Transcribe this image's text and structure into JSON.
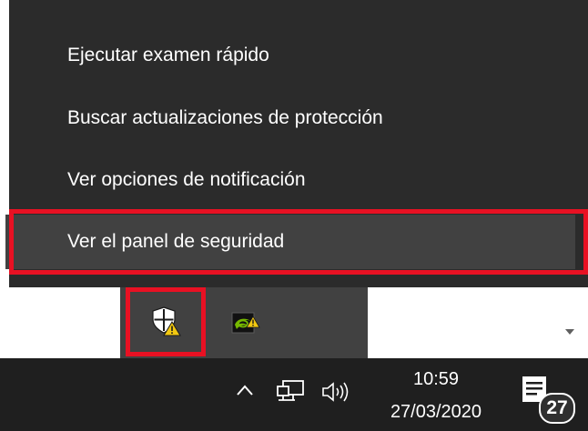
{
  "context_menu": {
    "items": [
      {
        "label": "Ejecutar examen rápido"
      },
      {
        "label": "Buscar actualizaciones de protección"
      },
      {
        "label": "Ver opciones de notificación"
      },
      {
        "label": "Ver el panel de seguridad"
      }
    ]
  },
  "tray_overflow": {
    "icons": [
      "windows-security-warning-icon",
      "nvidia-icon"
    ]
  },
  "taskbar": {
    "time": "10:59",
    "date": "27/03/2020",
    "notification_count": "27",
    "icons": [
      "chevron-up-icon",
      "network-icon",
      "volume-icon",
      "action-center-icon"
    ]
  },
  "colors": {
    "menu_bg": "#2b2b2b",
    "menu_hover": "#414141",
    "highlight": "#e81123",
    "taskbar_bg": "#1f1f1f",
    "warning": "#f2c811",
    "nvidia_green": "#76b900"
  }
}
